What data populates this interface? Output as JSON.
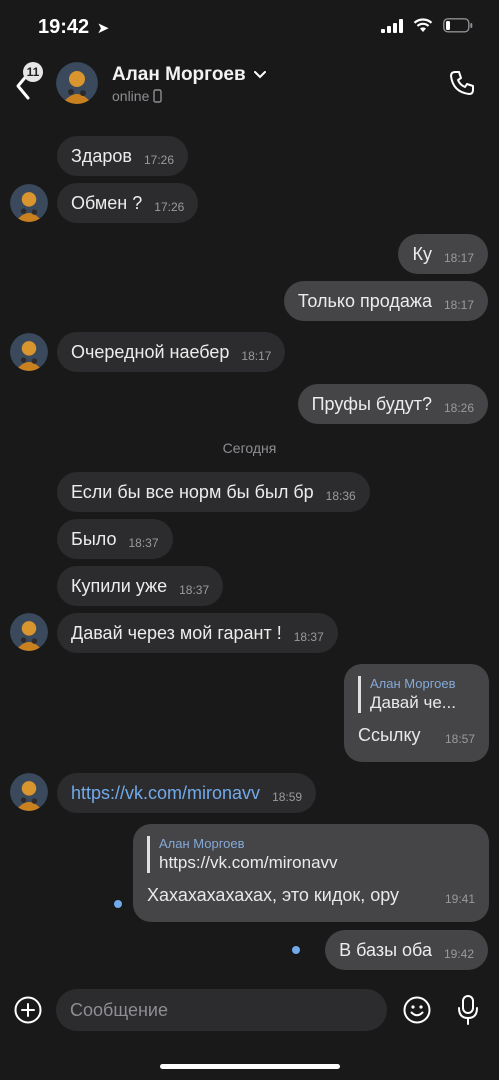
{
  "status": {
    "time": "19:42"
  },
  "header": {
    "back_badge": "11",
    "contact_name": "Алан Моргоев",
    "contact_status": "online"
  },
  "messages": [
    {
      "text": "Здаров",
      "time": "17:26"
    },
    {
      "text": "Обмен ?",
      "time": "17:26"
    },
    {
      "text": "Ку",
      "time": "18:17"
    },
    {
      "text": "Только продажа",
      "time": "18:17"
    },
    {
      "text": "Очередной наебер",
      "time": "18:17"
    },
    {
      "text": "Пруфы будут?",
      "time": "18:26"
    },
    {
      "text": "Если бы все норм бы был бр",
      "time": "18:36"
    },
    {
      "text": "Было",
      "time": "18:37"
    },
    {
      "text": "Купили уже",
      "time": "18:37"
    },
    {
      "text": "Давай через мой гарант !",
      "time": "18:37"
    },
    {
      "quote_author": "Алан Моргоев",
      "quote_text": "Давай че...",
      "text": "Ссылку",
      "time": "18:57"
    },
    {
      "text": "https://vk.com/mironavv",
      "time": "18:59"
    },
    {
      "quote_author": "Алан Моргоев",
      "quote_text": "https://vk.com/mironavv",
      "text": "Хахахахахахах, это кидок, ору",
      "time": "19:41"
    },
    {
      "text": "В базы оба",
      "time": "19:42"
    }
  ],
  "date_separator": "Сегодня",
  "composer": {
    "placeholder": "Сообщение"
  },
  "colors": {
    "background": "#19191a",
    "incoming": "#2c2c2e",
    "outgoing": "#454547",
    "link": "#71aaeb"
  }
}
